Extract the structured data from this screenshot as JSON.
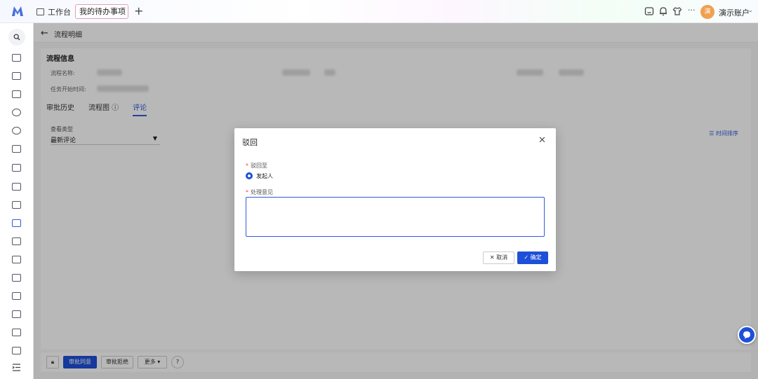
{
  "topbar": {
    "home_tab": "工作台",
    "active_tab": "我的待办事项",
    "add_tab": "+",
    "avatar_text": "演",
    "user_name": "演示账户",
    "more": "···"
  },
  "page": {
    "back": "←",
    "title": "流程明细"
  },
  "info": {
    "section_title": "流程信息",
    "field_flow_name": "流程名称:",
    "field_start_time": "任务开始时间:"
  },
  "tabs": {
    "history": "审批历史",
    "diagram": "流程图 ⓘ",
    "comments": "评论"
  },
  "view": {
    "label": "查看类型",
    "selected": "最新评论",
    "sort": "时间排序"
  },
  "footer": {
    "approve": "审批同意",
    "reject": "审批拒绝",
    "more": "更多 ▾",
    "help": "?"
  },
  "modal": {
    "title": "驳回",
    "close": "✕",
    "return_to_label": "驳回至",
    "return_to_option": "发起人",
    "comment_label": "处理意见",
    "cancel": "✕ 取消",
    "ok": "✓ 确定"
  },
  "colors": {
    "accent": "#1e4fd8",
    "required": "#e5484d"
  }
}
